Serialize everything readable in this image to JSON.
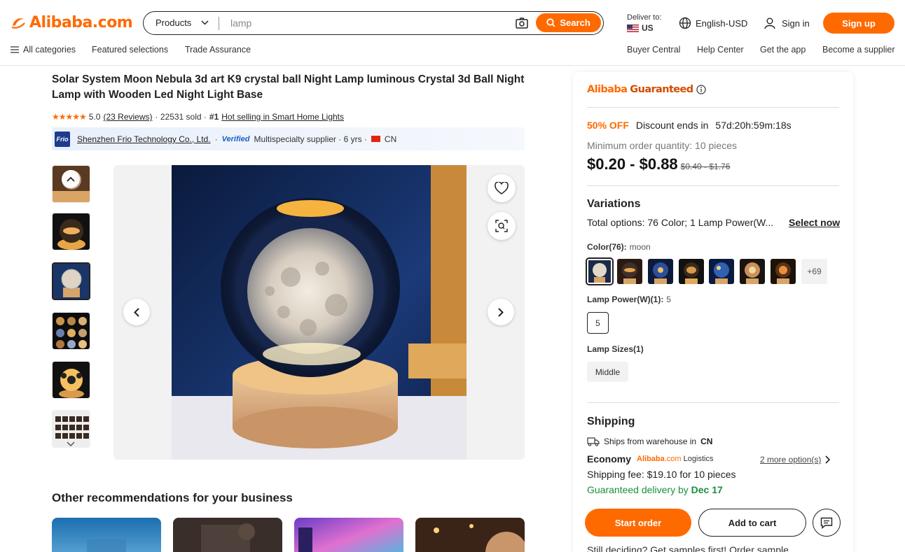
{
  "header": {
    "logo": "Alibaba.com",
    "search": {
      "category": "Products",
      "query": "lamp",
      "button": "Search"
    },
    "deliver_label": "Deliver to:",
    "deliver_country": "US",
    "language": "English-USD",
    "sign_in": "Sign in",
    "sign_up": "Sign up",
    "subnav_left": [
      "All categories",
      "Featured selections",
      "Trade Assurance"
    ],
    "subnav_right": [
      "Buyer Central",
      "Help Center",
      "Get the app",
      "Become a supplier"
    ]
  },
  "product": {
    "title": "Solar System Moon Nebula 3d art K9 crystal ball Night Lamp luminous Crystal 3d Ball Night Lamp with Wooden Led Night Light Base",
    "rating": "5.0",
    "reviews": "(23 Reviews)",
    "sold": "· 22531 sold ·",
    "rank": "#1",
    "rank_text": "Hot selling in Smart Home Lights",
    "supplier_logo": "Frio",
    "supplier": "Shenzhen Frio Technology Co., Ltd.",
    "verified": "Verified",
    "supplier_info": "Multispecialty supplier · 6 yrs ·",
    "country": "CN"
  },
  "recommendations": {
    "title": "Other recommendations for your business"
  },
  "panel": {
    "guaranteed_a": "Alibaba",
    "guaranteed_b": "Guaranteed",
    "discount_pct": "50% OFF",
    "discount_text": "Discount ends in",
    "countdown": "57d:20h:59m:18s",
    "moq": "Minimum order quantity: 10 pieces",
    "price": "$0.20 - $0.88",
    "old_price": "$0.40 - $1.76",
    "variations_title": "Variations",
    "variations_total": "Total options: 76 Color; 1 Lamp Power(W...",
    "select_now": "Select now",
    "color_label": "Color(76):",
    "color_value": "moon",
    "more_colors": "+69",
    "power_label": "Lamp Power(W)(1):",
    "power_value": "5",
    "power_option": "5",
    "size_label": "Lamp Sizes(1)",
    "size_option": "Middle",
    "shipping_title": "Shipping",
    "ships_from": "Ships from warehouse in",
    "ships_country": "CN",
    "economy": "Economy",
    "logistics_brand": "Alibaba",
    "logistics_dotcom": ".com",
    "logistics": "Logistics",
    "more_options": "2 more option(s)",
    "shipping_fee": "Shipping fee: $19.10 for 10 pieces",
    "guaranteed_delivery": "Guaranteed delivery by",
    "delivery_date": "Dec 17",
    "start_order": "Start order",
    "add_to_cart": "Add to cart",
    "still_deciding": "Still deciding? Get samples first! Order sample"
  },
  "colors": {
    "accent": "#ff6a00",
    "green": "#1b8f3c"
  }
}
